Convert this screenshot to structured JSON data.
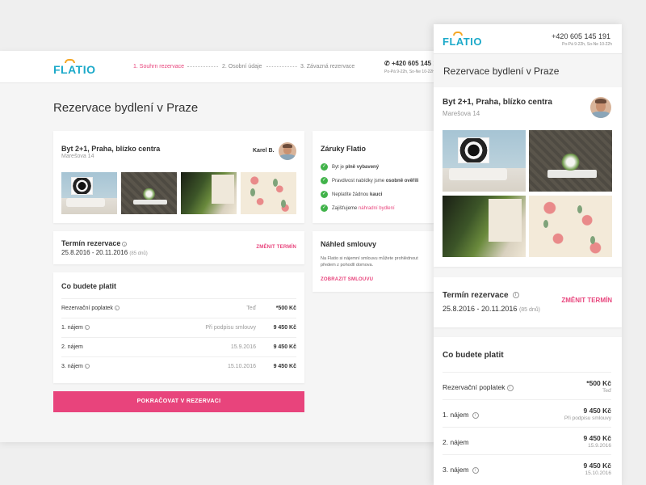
{
  "brand": {
    "logo": "FLATIO",
    "accent": "#e8447c",
    "logo_color": "#1ba9c9",
    "arc_color": "#f5a623",
    "check_color": "#41b34a"
  },
  "steps": [
    {
      "label": "1. Souhrn rezervace",
      "active": true
    },
    {
      "label": "2. Osobní údaje",
      "active": false
    },
    {
      "label": "3. Závazná rezervace",
      "active": false
    }
  ],
  "contact": {
    "phone": "+420 605 145 191",
    "hours": "Po-Pá 9-22h, So-Ne 10-22h"
  },
  "page_title": "Rezervace bydlení v Praze",
  "property": {
    "title": "Byt 2+1, Praha, blízko centra",
    "address": "Marešova 14",
    "host": "Karel B."
  },
  "guarantees": {
    "title": "Záruky Flatio",
    "items": [
      {
        "pre": "Byt je ",
        "bold": "plně vybavený",
        "post": "",
        "link": ""
      },
      {
        "pre": "Pravdivost nabídky jsme ",
        "bold": "osobně ověřili",
        "post": "",
        "link": ""
      },
      {
        "pre": "Neplatíte žádnou ",
        "bold": "kauci",
        "post": "",
        "link": ""
      },
      {
        "pre": "Zajišťujeme ",
        "bold": "",
        "post": "",
        "link": "náhradní bydlení"
      }
    ]
  },
  "term": {
    "title": "Termín rezervace",
    "range": "25.8.2016 - 20.11.2016",
    "days": "(85 dnů)",
    "change_label_desktop": "ZMĚNIT TERMÍN",
    "change_label_mobile": "ZMĚNIT TERMÍN"
  },
  "contract": {
    "title": "Náhled smlouvy",
    "text": "Na Flatio si nájemní smlouvu můžete prohlédnout předem z pohodlí domova.",
    "link": "ZOBRAZIT SMLOUVU"
  },
  "payments": {
    "title": "Co budete platit",
    "rows": [
      {
        "label": "Rezervační poplatek",
        "info": true,
        "when": "Teď",
        "amount": "*500 Kč"
      },
      {
        "label": "1. nájem",
        "info": true,
        "when": "Při podpisu smlouvy",
        "amount": "9 450 Kč"
      },
      {
        "label": "2. nájem",
        "info": false,
        "when": "15.9.2016",
        "amount": "9 450 Kč"
      },
      {
        "label": "3. nájem",
        "info": true,
        "when": "15.10.2016",
        "amount": "9 450 Kč"
      }
    ]
  },
  "cta": {
    "label": "POKRAČOVAT V REZERVACI"
  },
  "icons": {
    "info": "info-icon",
    "check": "check-circle-icon",
    "phone": "phone-icon"
  }
}
